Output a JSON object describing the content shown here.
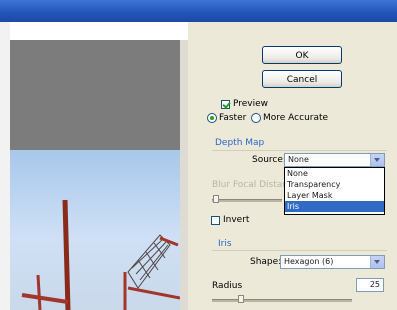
{
  "buttons": {
    "ok": "OK",
    "cancel": "Cancel"
  },
  "options": {
    "preview_label": "Preview",
    "preview_checked": true,
    "faster_label": "Faster",
    "more_accurate_label": "More Accurate",
    "mode_selected": "Faster"
  },
  "depth_map": {
    "section_label": "Depth Map",
    "source_label": "Source:",
    "source_value": "None",
    "source_options": [
      "None",
      "Transparency",
      "Layer Mask",
      "Iris"
    ],
    "highlighted_option": "Iris",
    "blur_focal_label": "Blur Focal Distance",
    "invert_label": "Invert",
    "invert_checked": false
  },
  "iris": {
    "section_label": "Iris",
    "shape_label": "Shape:",
    "shape_value": "Hexagon (6)",
    "radius_label": "Radius",
    "radius_value": "25"
  },
  "colors": {
    "titlebar": "#2254b8",
    "dialog_bg": "#ece9d8",
    "section_blue": "#2f64c8",
    "highlight": "#316ac5"
  }
}
